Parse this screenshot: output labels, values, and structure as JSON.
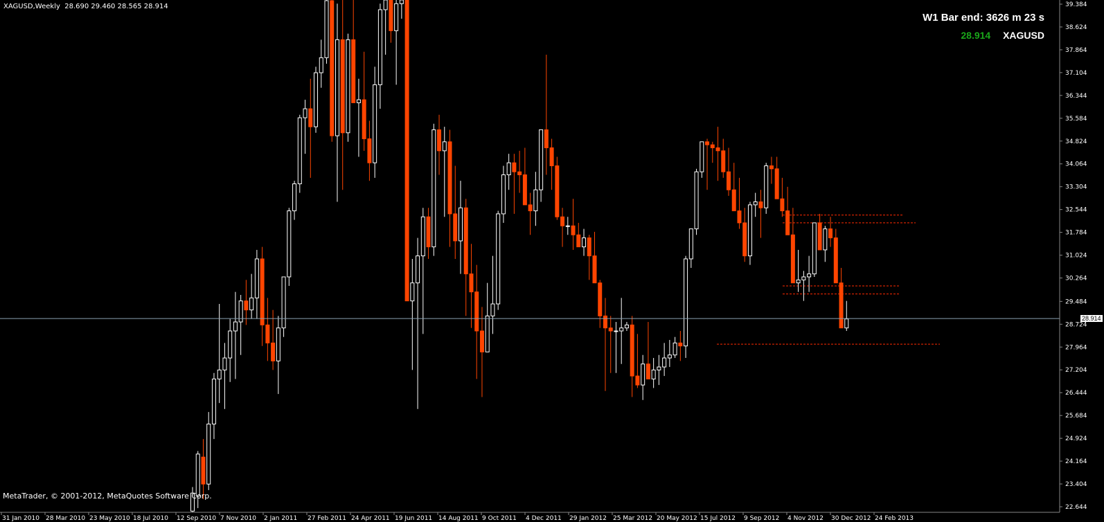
{
  "header": {
    "symbol_info": "XAGUSD,Weekly  28.690 29.460 28.565 28.914"
  },
  "bar_end": {
    "label": "W1 Bar end: 3626 m 23 s"
  },
  "symbol_box": {
    "price": "28.914",
    "symbol": "XAGUSD"
  },
  "footer": {
    "copyright": "MetaTrader, © 2001-2012, MetaQuotes Software Corp."
  },
  "price_axis": {
    "labels": [
      "39.384",
      "38.624",
      "37.864",
      "37.104",
      "36.344",
      "35.584",
      "34.824",
      "34.064",
      "33.304",
      "32.544",
      "31.784",
      "31.024",
      "30.264",
      "29.484",
      "28.724",
      "27.964",
      "27.204",
      "26.444",
      "25.684",
      "24.924",
      "24.164",
      "23.404",
      "22.644"
    ],
    "current_price_label": "28.914"
  },
  "time_axis": {
    "labels": [
      "31 Jan 2010",
      "28 Mar 2010",
      "23 May 2010",
      "18 Jul 2010",
      "12 Sep 2010",
      "7 Nov 2010",
      "2 Jan 2011",
      "27 Feb 2011",
      "24 Apr 2011",
      "19 Jun 2011",
      "14 Aug 2011",
      "9 Oct 2011",
      "4 Dec 2011",
      "29 Jan 2012",
      "25 Mar 2012",
      "20 May 2012",
      "15 Jul 2012",
      "9 Sep 2012",
      "4 Nov 2012",
      "30 Dec 2012",
      "24 Feb 2013"
    ]
  },
  "colors": {
    "background": "#000000",
    "bull": "#ffffff",
    "bear": "#ff4500",
    "current_price_line": "#8aa0b0",
    "level_lines": "#ff2a00"
  },
  "chart_data": {
    "type": "candlestick",
    "title": "XAGUSD,Weekly",
    "ylim": [
      22.644,
      39.384
    ],
    "current_price": 28.914,
    "horizontal_levels": [
      32.36,
      32.1,
      30.0,
      29.73,
      28.06
    ],
    "candles": [
      [
        22.5,
        23.3,
        22.3,
        23.1
      ],
      [
        23.0,
        24.5,
        22.6,
        24.4
      ],
      [
        24.3,
        24.9,
        22.9,
        23.4
      ],
      [
        23.4,
        25.8,
        23.2,
        25.4
      ],
      [
        25.4,
        27.1,
        24.9,
        26.9
      ],
      [
        26.9,
        29.4,
        26.1,
        27.2
      ],
      [
        27.2,
        28.1,
        25.9,
        27.6
      ],
      [
        27.6,
        28.9,
        26.8,
        28.5
      ],
      [
        28.5,
        29.8,
        26.9,
        28.8
      ],
      [
        28.8,
        29.7,
        27.7,
        29.5
      ],
      [
        29.5,
        30.2,
        28.7,
        29.2
      ],
      [
        29.2,
        30.4,
        28.9,
        29.6
      ],
      [
        29.6,
        31.2,
        28.9,
        30.9
      ],
      [
        30.9,
        31.3,
        28.0,
        28.7
      ],
      [
        28.7,
        29.6,
        27.5,
        28.1
      ],
      [
        28.1,
        29.2,
        27.2,
        27.5
      ],
      [
        27.5,
        29.0,
        26.4,
        28.6
      ],
      [
        28.6,
        30.2,
        28.3,
        30.3
      ],
      [
        30.3,
        32.6,
        30.0,
        32.5
      ],
      [
        32.5,
        33.5,
        32.2,
        33.4
      ],
      [
        33.4,
        35.7,
        33.1,
        35.6
      ],
      [
        35.6,
        36.2,
        34.4,
        35.9
      ],
      [
        35.9,
        36.9,
        33.6,
        35.3
      ],
      [
        35.3,
        37.3,
        35.1,
        37.1
      ],
      [
        37.1,
        38.2,
        36.6,
        37.6
      ],
      [
        37.6,
        39.8,
        37.4,
        39.5
      ],
      [
        39.5,
        40.5,
        34.8,
        35.0
      ],
      [
        35.0,
        39.4,
        32.8,
        38.2
      ],
      [
        38.2,
        39.8,
        33.2,
        35.1
      ],
      [
        35.1,
        38.4,
        34.8,
        38.2
      ],
      [
        38.2,
        40.0,
        36.3,
        36.1
      ],
      [
        36.1,
        36.9,
        34.3,
        36.2
      ],
      [
        36.2,
        37.8,
        34.5,
        34.9
      ],
      [
        34.9,
        35.5,
        33.5,
        34.1
      ],
      [
        34.1,
        37.3,
        33.6,
        36.7
      ],
      [
        36.7,
        39.4,
        35.9,
        39.2
      ],
      [
        39.2,
        40.5,
        37.7,
        40.4
      ],
      [
        40.4,
        40.8,
        38.1,
        38.5
      ],
      [
        38.5,
        39.6,
        36.7,
        39.4
      ],
      [
        39.4,
        40.5,
        38.9,
        39.6
      ],
      [
        39.6,
        40.1,
        37.0,
        29.5
      ],
      [
        29.5,
        30.9,
        27.2,
        30.1
      ],
      [
        30.1,
        31.6,
        25.9,
        31.0
      ],
      [
        31.0,
        32.6,
        28.4,
        32.3
      ],
      [
        32.3,
        32.6,
        30.9,
        31.3
      ],
      [
        31.3,
        35.4,
        31.0,
        35.2
      ],
      [
        35.2,
        35.7,
        33.7,
        34.5
      ],
      [
        34.5,
        35.3,
        32.3,
        34.8
      ],
      [
        34.8,
        35.2,
        31.3,
        32.4
      ],
      [
        32.4,
        34.0,
        30.9,
        31.5
      ],
      [
        31.5,
        33.5,
        30.4,
        32.6
      ],
      [
        32.6,
        32.9,
        29.0,
        30.4
      ],
      [
        30.4,
        31.4,
        28.6,
        29.8
      ],
      [
        29.8,
        30.7,
        26.9,
        28.5
      ],
      [
        28.5,
        29.3,
        26.3,
        27.8
      ],
      [
        27.8,
        30.1,
        27.8,
        29.0
      ],
      [
        29.0,
        31.0,
        28.4,
        29.4
      ],
      [
        29.4,
        32.5,
        29.2,
        32.4
      ],
      [
        32.4,
        34.0,
        32.1,
        33.7
      ],
      [
        33.7,
        34.4,
        33.2,
        34.1
      ],
      [
        34.1,
        34.4,
        32.4,
        33.8
      ],
      [
        33.8,
        34.5,
        33.1,
        33.7
      ],
      [
        33.7,
        34.6,
        32.9,
        32.7
      ],
      [
        32.7,
        33.1,
        31.7,
        32.5
      ],
      [
        32.5,
        33.8,
        32.0,
        33.2
      ],
      [
        33.2,
        35.0,
        32.8,
        35.2
      ],
      [
        35.2,
        37.7,
        33.7,
        34.6
      ],
      [
        34.6,
        34.9,
        33.2,
        34.0
      ],
      [
        34.0,
        34.3,
        32.2,
        32.3
      ],
      [
        32.3,
        32.6,
        31.3,
        32.0
      ],
      [
        32.0,
        32.3,
        31.7,
        32.0
      ],
      [
        32.0,
        32.9,
        31.2,
        31.7
      ],
      [
        31.7,
        32.1,
        31.3,
        31.3
      ],
      [
        31.3,
        31.9,
        31.0,
        31.6
      ],
      [
        31.6,
        31.7,
        30.2,
        31.0
      ],
      [
        31.0,
        31.8,
        30.6,
        30.1
      ],
      [
        30.1,
        30.2,
        28.6,
        29.0
      ],
      [
        29.0,
        29.6,
        26.5,
        28.6
      ],
      [
        28.6,
        29.0,
        27.1,
        28.5
      ],
      [
        28.5,
        28.8,
        27.1,
        28.5
      ],
      [
        28.5,
        29.6,
        27.4,
        28.6
      ],
      [
        28.6,
        28.8,
        28.5,
        28.7
      ],
      [
        28.7,
        29.0,
        26.3,
        27.0
      ],
      [
        27.0,
        28.4,
        26.6,
        26.7
      ],
      [
        26.7,
        27.7,
        26.2,
        27.4
      ],
      [
        27.4,
        28.8,
        27.1,
        26.9
      ],
      [
        26.9,
        27.6,
        26.6,
        27.2
      ],
      [
        27.2,
        27.7,
        26.7,
        27.3
      ],
      [
        27.3,
        28.1,
        27.0,
        27.6
      ],
      [
        27.6,
        28.2,
        27.3,
        27.7
      ],
      [
        27.7,
        28.3,
        27.6,
        28.1
      ],
      [
        28.1,
        28.5,
        27.5,
        28.0
      ],
      [
        28.0,
        31.0,
        27.6,
        30.9
      ],
      [
        30.9,
        31.9,
        30.6,
        31.9
      ],
      [
        31.9,
        33.9,
        31.7,
        33.8
      ],
      [
        33.8,
        34.8,
        33.6,
        34.8
      ],
      [
        34.8,
        34.9,
        33.2,
        34.7
      ],
      [
        34.7,
        34.8,
        34.1,
        34.6
      ],
      [
        34.6,
        35.3,
        33.5,
        34.5
      ],
      [
        34.5,
        34.9,
        33.6,
        33.8
      ],
      [
        33.8,
        34.6,
        33.0,
        33.2
      ],
      [
        33.2,
        34.1,
        32.5,
        32.5
      ],
      [
        32.5,
        33.6,
        31.9,
        32.1
      ],
      [
        32.1,
        32.6,
        30.8,
        31.0
      ],
      [
        31.0,
        32.8,
        30.7,
        32.7
      ],
      [
        32.7,
        33.1,
        32.3,
        32.8
      ],
      [
        32.8,
        33.2,
        31.6,
        32.6
      ],
      [
        32.6,
        34.1,
        32.4,
        34.0
      ],
      [
        34.0,
        34.3,
        33.4,
        33.9
      ],
      [
        33.9,
        34.3,
        32.9,
        32.9
      ],
      [
        32.9,
        33.6,
        32.3,
        32.5
      ],
      [
        32.5,
        33.3,
        31.9,
        31.7
      ],
      [
        31.7,
        32.6,
        30.1,
        30.1
      ],
      [
        30.1,
        31.2,
        29.8,
        30.2
      ],
      [
        30.2,
        30.5,
        29.5,
        30.3
      ],
      [
        30.3,
        31.0,
        29.8,
        30.4
      ],
      [
        30.4,
        31.5,
        30.3,
        32.1
      ],
      [
        32.1,
        32.4,
        31.3,
        31.2
      ],
      [
        31.2,
        32.0,
        30.8,
        31.9
      ],
      [
        31.9,
        32.3,
        31.3,
        31.6
      ],
      [
        31.6,
        31.9,
        30.6,
        30.1
      ],
      [
        30.1,
        30.6,
        28.6,
        28.6
      ],
      [
        28.6,
        29.5,
        28.5,
        28.9
      ]
    ]
  }
}
